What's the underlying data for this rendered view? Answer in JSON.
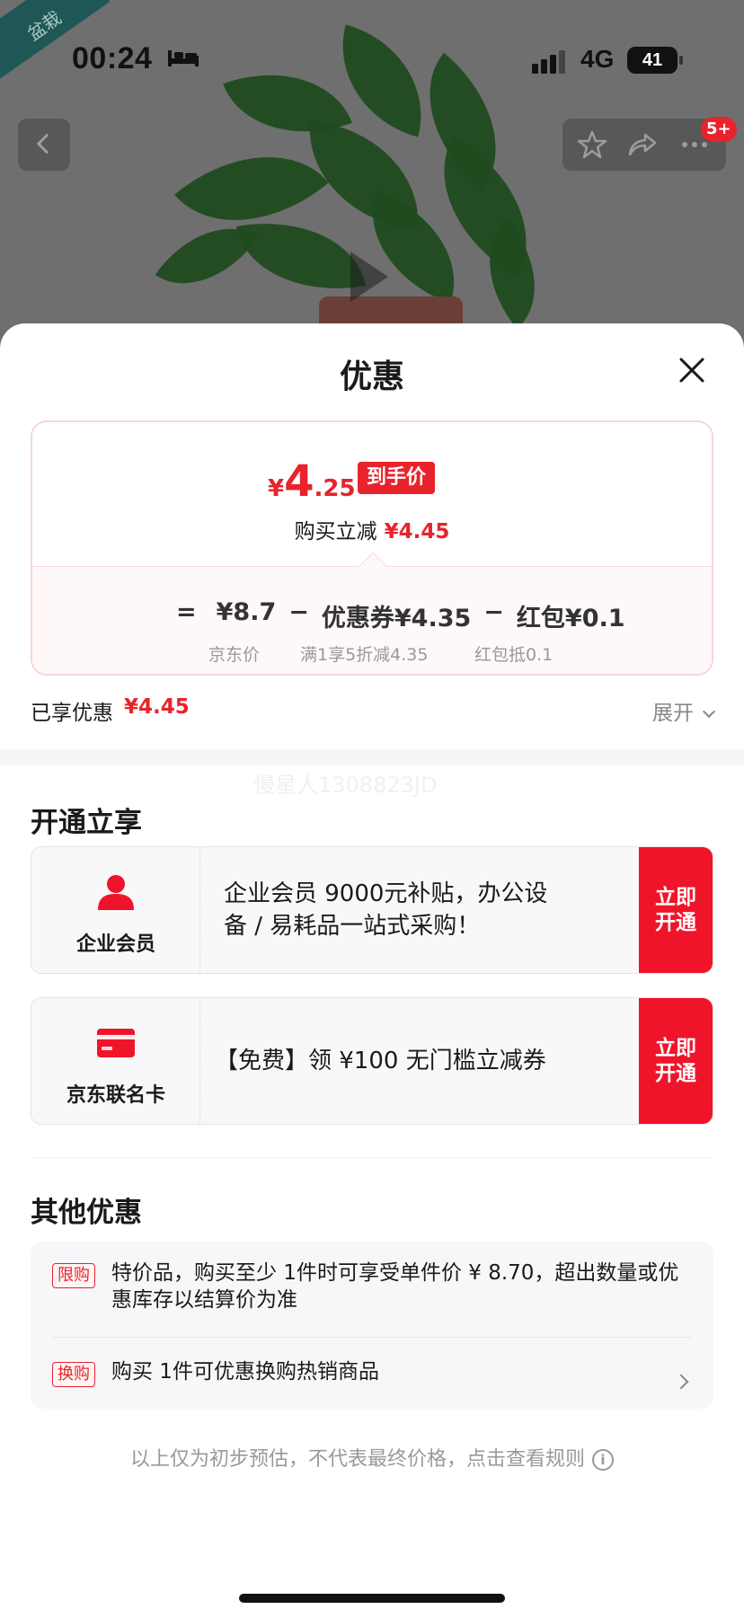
{
  "status_bar": {
    "time": "00:24",
    "network": "4G",
    "battery": "41"
  },
  "product_bg": {
    "corner_tag": "盆栽",
    "cart_badge": "5+"
  },
  "sheet": {
    "title": "优惠",
    "price": {
      "yen": "¥",
      "integer": "4",
      "decimal": ".25",
      "tag": "到手价",
      "reduce_label": "购买立减",
      "reduce_amount": "¥4.45"
    },
    "calc": {
      "eq": "=",
      "base_value": "¥8.7",
      "minus1": "−",
      "coupon_value": "优惠券¥4.35",
      "minus2": "−",
      "hongbao_value": "红包¥0.1",
      "base_sub": "京东价",
      "coupon_sub": "满1享5折减4.35",
      "hongbao_sub": "红包抵0.1"
    },
    "enjoyed": {
      "label": "已享优惠",
      "amount": "¥4.45",
      "expand": "展开"
    },
    "watermark": "慢星人1308823JD",
    "open_section": {
      "title": "开通立享",
      "cards": [
        {
          "name": "企业会员",
          "desc": "企业会员 9000元补贴，办公设备 / 易耗品一站式采购！",
          "button": "立即开通",
          "icon": "person-icon"
        },
        {
          "name": "京东联名卡",
          "desc": "【免费】领 ¥100 无门槛立减券",
          "button": "立即开通",
          "icon": "card-icon"
        }
      ]
    },
    "other_section": {
      "title": "其他优惠",
      "items": [
        {
          "tag": "限购",
          "text": "特价品，购买至少 1件时可享受单件价 ¥ 8.70，超出数量或优惠库存以结算价为准"
        },
        {
          "tag": "换购",
          "text": "购买 1件可优惠换购热销商品"
        }
      ]
    },
    "footer": "以上仅为初步预估，不代表最终价格，点击查看规则",
    "colors": {
      "accent": "#e8232b",
      "button": "#f0142a"
    }
  }
}
